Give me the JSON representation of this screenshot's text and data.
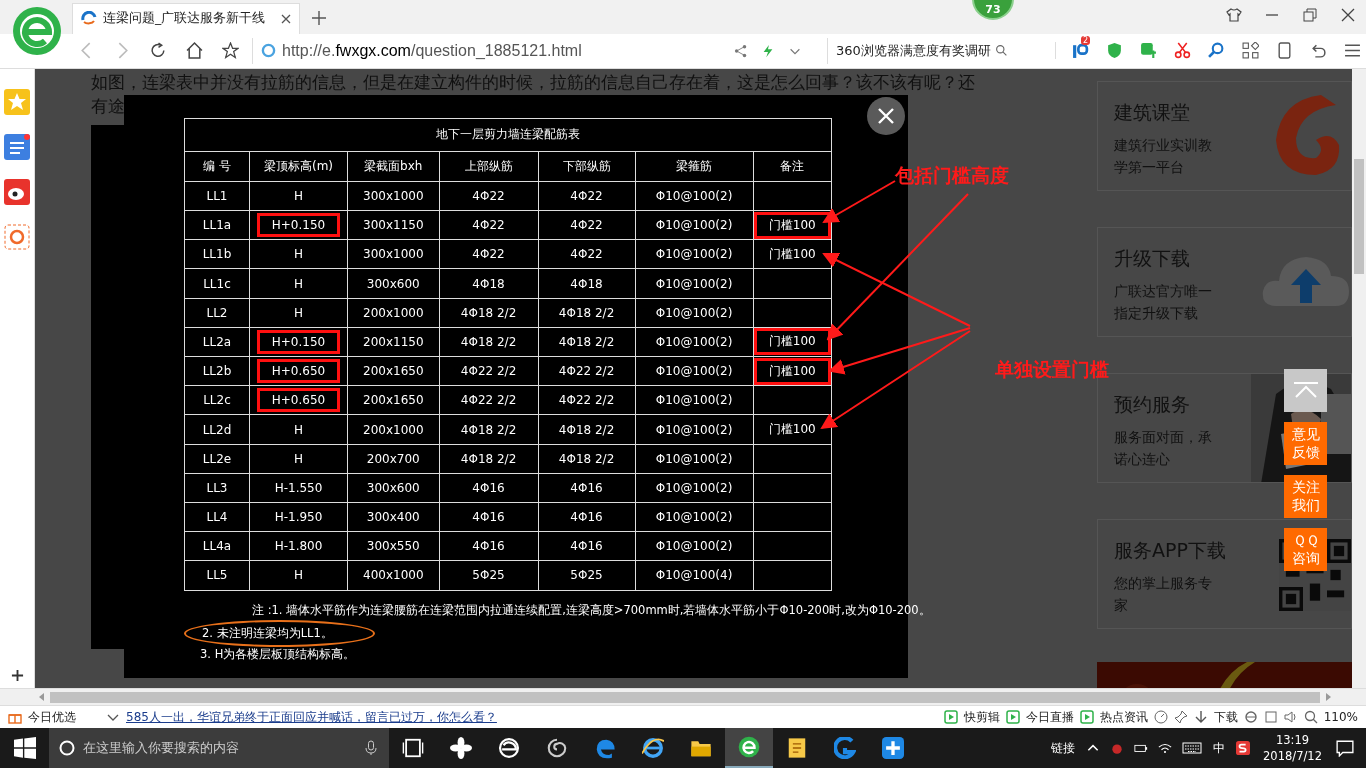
{
  "browser": {
    "tab_title": "连梁问题_广联达服务新干线",
    "badge": "73",
    "url_prefix": "http://e.",
    "url_domain": "fwxgx.com",
    "url_path": "/question_1885121.html",
    "search": "360浏览器满意度有奖调研",
    "ext_badge": "2"
  },
  "question_lines": [
    "如图，连梁表中并没有拉筋的信息，但是在建立构件的时候，拉筋的信息自己存在着，这是怎么回事？该不该有呢？还",
    "有途"
  ],
  "table": {
    "title": "地下一层剪力墙连梁配筋表",
    "columns": [
      "编 号",
      "梁顶标高(m)",
      "梁截面bxh",
      "上部纵筋",
      "下部纵筋",
      "梁箍筋",
      "备注"
    ],
    "rows": [
      {
        "id": "LL1",
        "height": "H",
        "section": "300x1000",
        "top": "4Φ22",
        "bottom": "4Φ22",
        "stirrup": "Φ10@100(2)",
        "height_marked": false
      },
      {
        "id": "LL1a",
        "height": "H+0.150",
        "section": "300x1150",
        "top": "4Φ22",
        "bottom": "4Φ22",
        "stirrup": "Φ10@100(2)",
        "note": "门槛100",
        "height_marked": true,
        "note_marked": true
      },
      {
        "id": "LL1b",
        "height": "H",
        "section": "300x1000",
        "top": "4Φ22",
        "bottom": "4Φ22",
        "stirrup": "Φ10@100(2)",
        "note": "门槛100",
        "height_marked": false,
        "note_marked": false
      },
      {
        "id": "LL1c",
        "height": "H",
        "section": "300x600",
        "top": "4Φ18",
        "bottom": "4Φ18",
        "stirrup": "Φ10@100(2)",
        "height_marked": false
      },
      {
        "id": "LL2",
        "height": "H",
        "section": "200x1000",
        "top": "4Φ18 2/2",
        "bottom": "4Φ18 2/2",
        "stirrup": "Φ10@100(2)",
        "height_marked": false
      },
      {
        "id": "LL2a",
        "height": "H+0.150",
        "section": "200x1150",
        "top": "4Φ18 2/2",
        "bottom": "4Φ18 2/2",
        "stirrup": "Φ10@100(2)",
        "note": "门槛100",
        "height_marked": true,
        "note_marked": true
      },
      {
        "id": "LL2b",
        "height": "H+0.650",
        "section": "200x1650",
        "top": "4Φ22 2/2",
        "bottom": "4Φ22 2/2",
        "stirrup": "Φ10@100(2)",
        "note": "门槛100",
        "height_marked": true,
        "note_marked": true
      },
      {
        "id": "LL2c",
        "height": "H+0.650",
        "section": "200x1650",
        "top": "4Φ22 2/2",
        "bottom": "4Φ22 2/2",
        "stirrup": "Φ10@100(2)",
        "height_marked": true
      },
      {
        "id": "LL2d",
        "height": "H",
        "section": "200x1000",
        "top": "4Φ18 2/2",
        "bottom": "4Φ18 2/2",
        "stirrup": "Φ10@100(2)",
        "note": "门槛100",
        "height_marked": false,
        "note_marked": false
      },
      {
        "id": "LL2e",
        "height": "H",
        "section": "200x700",
        "top": "4Φ18 2/2",
        "bottom": "4Φ18 2/2",
        "stirrup": "Φ10@100(2)",
        "height_marked": false
      },
      {
        "id": "LL3",
        "height": "H-1.550",
        "section": "300x600",
        "top": "4Φ16",
        "bottom": "4Φ16",
        "stirrup": "Φ10@100(2)",
        "height_marked": false
      },
      {
        "id": "LL4",
        "height": "H-1.950",
        "section": "300x400",
        "top": "4Φ16",
        "bottom": "4Φ16",
        "stirrup": "Φ10@100(2)",
        "height_marked": false
      },
      {
        "id": "LL4a",
        "height": "H-1.800",
        "section": "300x550",
        "top": "4Φ16",
        "bottom": "4Φ16",
        "stirrup": "Φ10@100(2)",
        "height_marked": false
      },
      {
        "id": "LL5",
        "height": "H",
        "section": "400x1000",
        "top": "5Φ25",
        "bottom": "5Φ25",
        "stirrup": "Φ10@100(4)",
        "height_marked": false
      }
    ],
    "notes": [
      {
        "text": "注 :1. 墙体水平筋作为连梁腰筋在连梁范围内拉通连续配置,连梁高度>700mm时,若墙体水平筋小于Φ10-200时,改为Φ10-200。",
        "circled": false
      },
      {
        "text": "2. 未注明连梁均为LL1。",
        "circled": true
      },
      {
        "text": "3. H为各楼层板顶结构标高。",
        "circled": false
      }
    ]
  },
  "callouts": [
    "包括门槛高度",
    "单独设置门槛"
  ],
  "cards": [
    {
      "title": "建筑课堂",
      "subtitle": "建筑行业实训教学第一平台",
      "kind": "swirl"
    },
    {
      "title": "升级下载",
      "subtitle": "广联达官方唯一指定升级下载",
      "kind": "cloud"
    },
    {
      "title": "预约服务",
      "subtitle": "服务面对面，承诺心连心"
    },
    {
      "title": "服务APP下载",
      "subtitle": "您的掌上服务专家",
      "kind": "qr"
    }
  ],
  "float_buttons": [
    "意见反馈",
    "关注我们",
    "ＱＱ咨询"
  ],
  "status_bar": {
    "left": "今日优选",
    "news": "585人一出，华谊兄弟终于正面回应并喊话，留言已过万，你怎么看？",
    "items": [
      "快剪辑",
      "今日直播",
      "热点资讯"
    ],
    "download": "下载",
    "zoom": "110%"
  },
  "taskbar": {
    "search_placeholder": "在这里输入你要搜索的内容",
    "links": "链接",
    "ime": "中",
    "time": "13:19",
    "date": "2018/7/12"
  }
}
